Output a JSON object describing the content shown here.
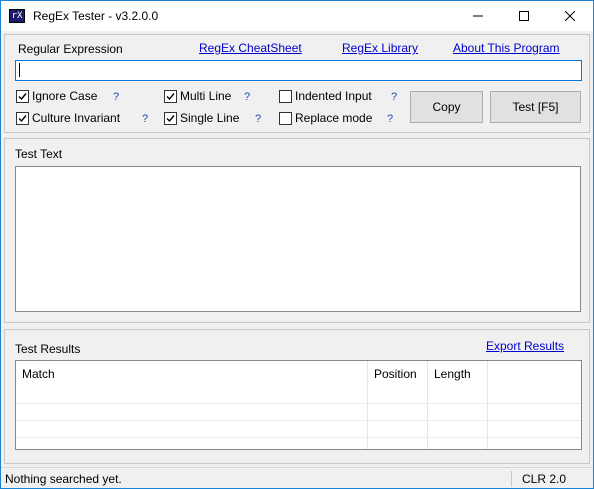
{
  "window": {
    "title": "RegEx Tester - v3.2.0.0",
    "icon_text": "rX",
    "controls": [
      "minimize",
      "maximize",
      "close"
    ]
  },
  "expression": {
    "label": "Regular Expression",
    "value": "",
    "links": {
      "cheatsheet": "RegEx CheatSheet",
      "library": "RegEx Library",
      "about": "About This Program"
    }
  },
  "options": [
    {
      "label": "Ignore Case",
      "checked": true,
      "help": "?"
    },
    {
      "label": "Culture Invariant",
      "checked": true,
      "help": "?"
    },
    {
      "label": "Multi Line",
      "checked": true,
      "help": "?"
    },
    {
      "label": "Single Line",
      "checked": true,
      "help": "?"
    },
    {
      "label": "Indented Input",
      "checked": false,
      "help": "?"
    },
    {
      "label": "Replace mode",
      "checked": false,
      "help": "?"
    }
  ],
  "buttons": {
    "copy": "Copy",
    "test": "Test [F5]"
  },
  "test_text": {
    "label": "Test Text",
    "value": ""
  },
  "results": {
    "label": "Test Results",
    "export": "Export Results",
    "columns": [
      "Match",
      "Position",
      "Length"
    ],
    "rows": []
  },
  "status": {
    "message": "Nothing searched yet.",
    "runtime": "CLR 2.0"
  },
  "colors": {
    "link": "#0000cc",
    "help": "#1a47b8",
    "focus_border": "#0078d7",
    "window_border": "#1883d7"
  }
}
